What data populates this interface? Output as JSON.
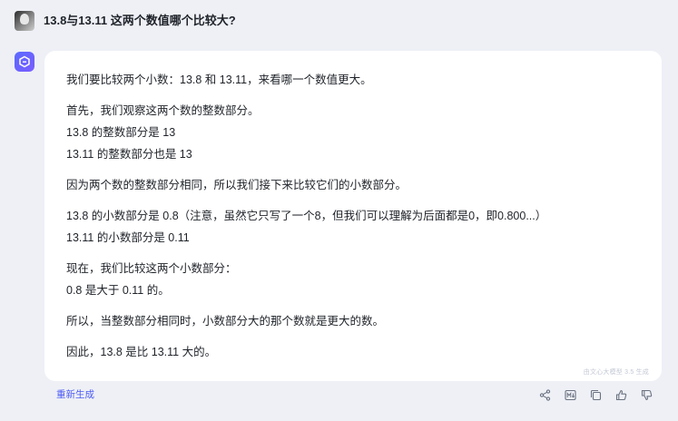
{
  "question": {
    "text": "13.8与13.11 这两个数值哪个比较大?"
  },
  "answer": {
    "paragraphs": [
      "我们要比较两个小数：13.8 和 13.11，来看哪一个数值更大。",
      "首先，我们观察这两个数的整数部分。",
      "13.8 的整数部分是 13",
      "13.11 的整数部分也是 13",
      "因为两个数的整数部分相同，所以我们接下来比较它们的小数部分。",
      "13.8 的小数部分是 0.8（注意，虽然它只写了一个8，但我们可以理解为后面都是0，即0.800...）",
      "13.11 的小数部分是 0.11",
      "现在，我们比较这两个小数部分：",
      "0.8 是大于 0.11 的。",
      "所以，当整数部分相同时，小数部分大的那个数就是更大的数。",
      "因此，13.8 是比 13.11 大的。"
    ],
    "watermark": "由文心大模型 3.5 生成"
  },
  "footer": {
    "regenerate_label": "重新生成",
    "actions": [
      "share-icon",
      "markdown-icon",
      "copy-icon",
      "thumbs-up-icon",
      "thumbs-down-icon"
    ]
  },
  "colors": {
    "background": "#eef0f6",
    "card": "#ffffff",
    "accent": "#4e5cf2"
  }
}
